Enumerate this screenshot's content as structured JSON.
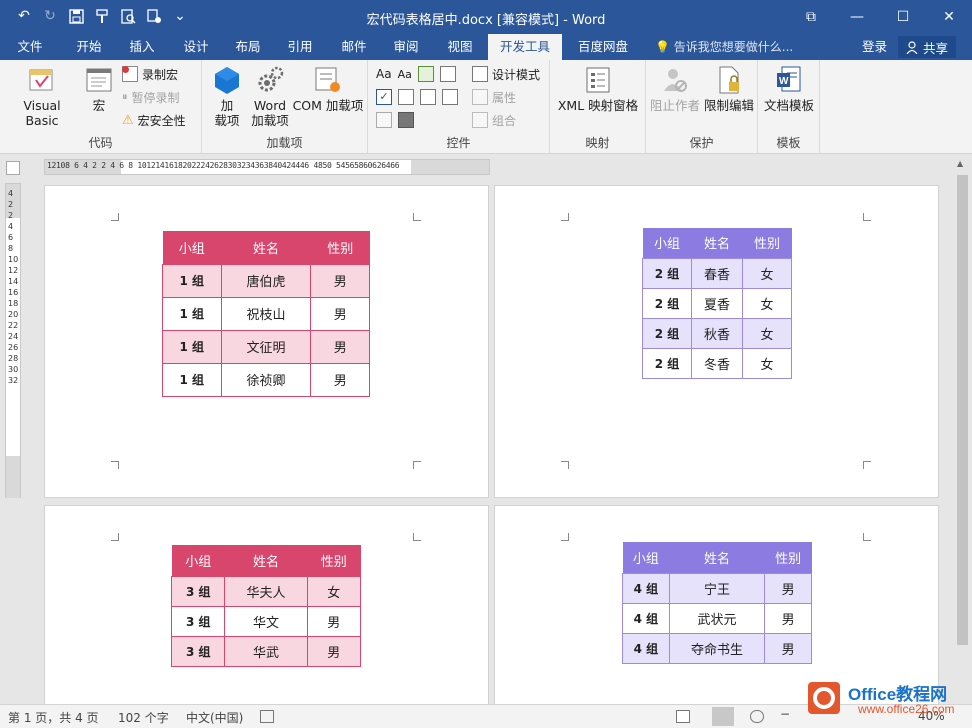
{
  "window": {
    "title": "宏代码表格居中.docx [兼容模式] - Word",
    "controls": {
      "restore": "⧉",
      "minimize": "—",
      "maximize": "☐",
      "close": "✕"
    }
  },
  "qat": {
    "undo": "↶",
    "redo": "↻",
    "save": "🖫",
    "customize": "⌄"
  },
  "tabs": [
    "文件",
    "开始",
    "插入",
    "设计",
    "布局",
    "引用",
    "邮件",
    "审阅",
    "视图",
    "开发工具",
    "百度网盘"
  ],
  "active_tab": "开发工具",
  "tell_me": "告诉我您想要做什么...",
  "login": "登录",
  "share": "共享",
  "ribbon": {
    "code": {
      "label": "代码",
      "visual_basic": "Visual Basic",
      "macros": "宏",
      "record_macro": "录制宏",
      "pause_recording": "暂停录制",
      "macro_security": "宏安全性"
    },
    "addins": {
      "label": "加载项",
      "addins_line1": "加",
      "addins_line2": "载项",
      "word_addins_line1": "Word",
      "word_addins_line2": "加载项",
      "com_addins": "COM 加载项"
    },
    "controls": {
      "label": "控件",
      "design_mode": "设计模式",
      "properties": "属性",
      "group": "组合"
    },
    "mapping": {
      "label": "映射",
      "xml_pane": "XML 映射窗格"
    },
    "protect": {
      "label": "保护",
      "block_authors": "阻止作者",
      "restrict_editing": "限制编辑"
    },
    "templates": {
      "label": "模板",
      "document_template": "文档模板"
    }
  },
  "ruler": {
    "h_numbers": "12108 6 4 2   2 4 6 8 10121416182022242628303234363840424446 4850  54565860626466",
    "v_numbers": [
      "4",
      "2",
      "",
      "2",
      "4",
      "6",
      "8",
      "10",
      "12",
      "14",
      "16",
      "18",
      "20",
      "22",
      "24",
      "26",
      "28",
      "30",
      "32"
    ]
  },
  "tables": [
    {
      "headers": [
        "小组",
        "姓名",
        "性别"
      ],
      "rows": [
        [
          "1 组",
          "唐伯虎",
          "男"
        ],
        [
          "1 组",
          "祝枝山",
          "男"
        ],
        [
          "1 组",
          "文征明",
          "男"
        ],
        [
          "1 组",
          "徐祯卿",
          "男"
        ]
      ]
    },
    {
      "headers": [
        "小组",
        "姓名",
        "性别"
      ],
      "rows": [
        [
          "2 组",
          "春香",
          "女"
        ],
        [
          "2 组",
          "夏香",
          "女"
        ],
        [
          "2 组",
          "秋香",
          "女"
        ],
        [
          "2 组",
          "冬香",
          "女"
        ]
      ]
    },
    {
      "headers": [
        "小组",
        "姓名",
        "性别"
      ],
      "rows": [
        [
          "3 组",
          "华夫人",
          "女"
        ],
        [
          "3 组",
          "华文",
          "男"
        ],
        [
          "3 组",
          "华武",
          "男"
        ]
      ]
    },
    {
      "headers": [
        "小组",
        "姓名",
        "性别"
      ],
      "rows": [
        [
          "4 组",
          "宁王",
          "男"
        ],
        [
          "4 组",
          "武状元",
          "男"
        ],
        [
          "4 组",
          "夺命书生",
          "男"
        ]
      ]
    }
  ],
  "status": {
    "page": "第 1 页，共 4 页",
    "words": "102 个字",
    "language": "中文(中国)",
    "zoom": "40%"
  },
  "watermark": {
    "brand": "Office教程网",
    "url": "www.office26.com"
  },
  "colors": {
    "word_blue": "#2b579a",
    "red_header": "#d8466e",
    "red_alt": "#f8d7e0",
    "purple_header": "#8c7be0",
    "purple_alt": "#e7e2fb"
  }
}
